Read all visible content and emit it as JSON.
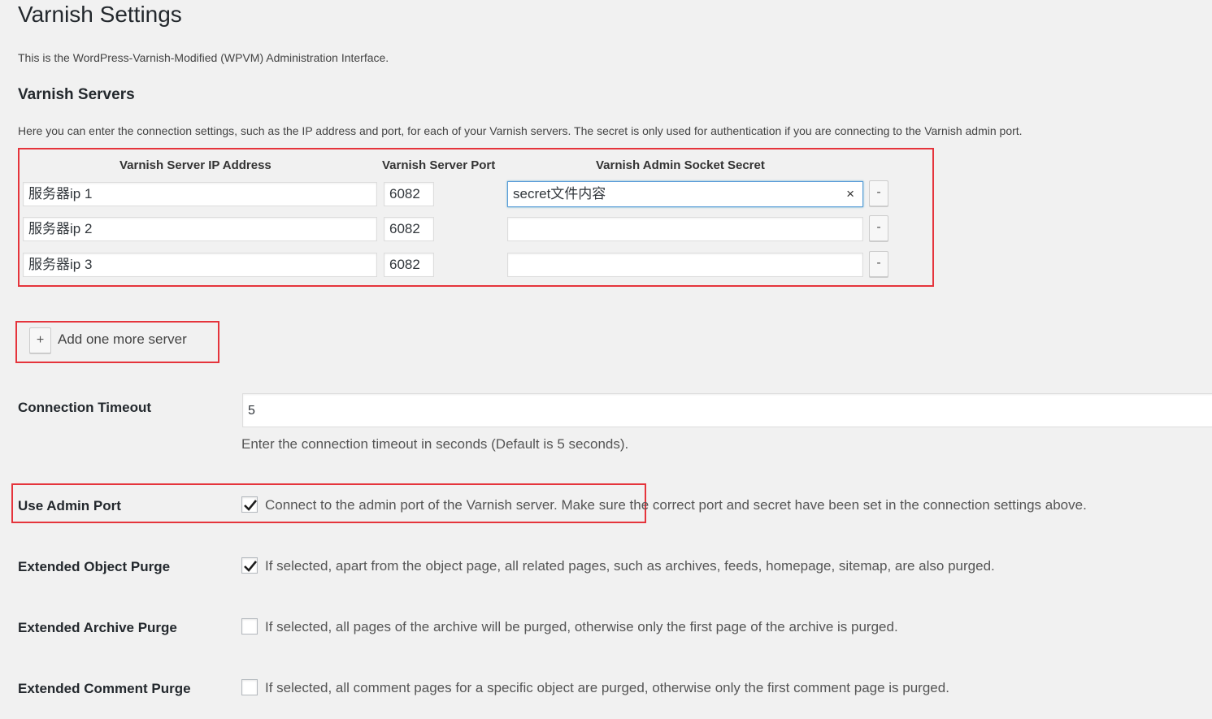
{
  "page": {
    "title": "Varnish Settings",
    "intro": "This is the WordPress-Varnish-Modified (WPVM) Administration Interface."
  },
  "servers": {
    "heading": "Varnish Servers",
    "description": "Here you can enter the connection settings, such as the IP address and port, for each of your Varnish servers. The secret is only used for authentication if you are connecting to the Varnish admin port.",
    "col_ip": "Varnish Server IP Address",
    "col_port": "Varnish Server Port",
    "col_secret": "Varnish Admin Socket Secret",
    "rows": [
      {
        "ip": "服务器ip  1",
        "port": "6082",
        "secret": "secret文件内容",
        "remove": "-"
      },
      {
        "ip": "服务器ip  2",
        "port": "6082",
        "secret": "",
        "remove": "-"
      },
      {
        "ip": "服务器ip  3",
        "port": "6082",
        "secret": "",
        "remove": "-"
      }
    ],
    "clear_icon": "×",
    "add_button": "+",
    "add_label": "Add one more server"
  },
  "timeout": {
    "label": "Connection Timeout",
    "value": "5",
    "note": "Enter the connection timeout in seconds (Default is 5 seconds)."
  },
  "options": [
    {
      "label": "Use Admin Port",
      "checked": true,
      "text": "Connect to the admin port of the Varnish server. Make sure the correct port and secret have been set in the connection settings above."
    },
    {
      "label": "Extended Object Purge",
      "checked": true,
      "text": "If selected, apart from the object page, all related pages, such as archives, feeds, homepage, sitemap, are also purged."
    },
    {
      "label": "Extended Archive Purge",
      "checked": false,
      "text": "If selected, all pages of the archive will be purged, otherwise only the first page of the archive is purged."
    },
    {
      "label": "Extended Comment Purge",
      "checked": false,
      "text": "If selected, all comment pages for a specific object are purged, otherwise only the first comment page is purged."
    }
  ],
  "colors": {
    "highlight": "#e5343c",
    "focus": "#5b9dd9"
  }
}
